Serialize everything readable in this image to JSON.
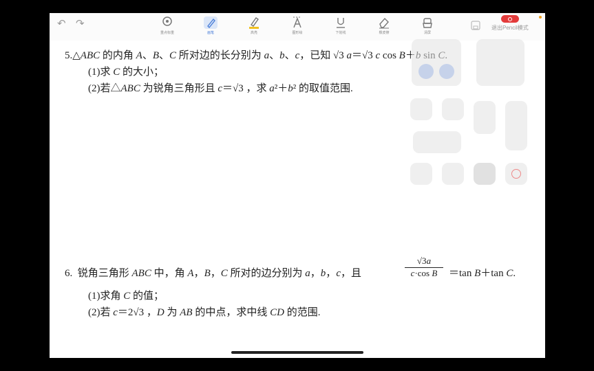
{
  "toolbar": {
    "tools": [
      {
        "label": "重点标重",
        "icon": "lasso-icon"
      },
      {
        "label": "画笔",
        "icon": "pen-icon"
      },
      {
        "label": "高亮",
        "icon": "highlighter-icon"
      },
      {
        "label": "图形绘",
        "icon": "text-icon"
      },
      {
        "label": "下划线",
        "icon": "underline-icon"
      },
      {
        "label": "橡皮擦",
        "icon": "eraser-icon"
      },
      {
        "label": "清屏",
        "icon": "clear-icon"
      }
    ],
    "exit_label": "退出Pencil模式"
  },
  "colors": {
    "accent": "#4a7ed8",
    "record": "#e33b3b",
    "status_dot": "#f0a020",
    "highlight": "#f0c020"
  },
  "problem5": {
    "q_num": "5.",
    "stem_a": "△",
    "stem_b": "ABC",
    "stem_c": " 的内角 ",
    "stem_d": "A",
    "stem_e": "、",
    "stem_f": "B",
    "stem_g": "、",
    "stem_h": "C",
    "stem_i": " 所对边的长分别为 ",
    "stem_j": "a",
    "stem_k": "、",
    "stem_l": "b",
    "stem_m": "、",
    "stem_n": "c",
    "stem_o": "，已知 √3  ",
    "stem_p": "a",
    "stem_q": "＝√3  ",
    "stem_r": "c",
    "stem_s": " cos ",
    "stem_t": "B",
    "stem_u": "＋",
    "stem_v": "b",
    "stem_w": " sin ",
    "stem_x": "C",
    "stem_y": ".",
    "part1_a": "(1)求 ",
    "part1_b": "C",
    "part1_c": " 的大小；",
    "part2_a": "(2)若△",
    "part2_b": "ABC",
    "part2_c": " 为锐角三角形且 ",
    "part2_d": "c",
    "part2_e": "＝√3 ，求 ",
    "part2_f": "a",
    "part2_g": "²＋",
    "part2_h": "b",
    "part2_i": "² 的取值范围."
  },
  "problem6": {
    "q_num": "6.",
    "stem_a": "锐角三角形 ",
    "stem_b": "ABC",
    "stem_c": " 中，角 ",
    "stem_d": "A",
    "stem_e": "，",
    "stem_f": "B",
    "stem_g": "，",
    "stem_h": "C",
    "stem_i": " 所对的边分别为 ",
    "stem_j": "a",
    "stem_k": "，",
    "stem_l": "b",
    "stem_m": "，",
    "stem_n": "c",
    "stem_o": "，且",
    "frac_num_a": "√3",
    "frac_num_b": "a",
    "frac_den_a": "c",
    "frac_den_b": "·cos ",
    "frac_den_c": "B",
    "stem_p": "＝tan ",
    "stem_q": "B",
    "stem_r": "＋tan ",
    "stem_s": "C",
    "stem_t": ".",
    "part1_a": "(1)求角 ",
    "part1_b": "C",
    "part1_c": " 的值；",
    "part2_a": "(2)若 ",
    "part2_b": "c",
    "part2_c": "＝2√3 ，",
    "part2_d": "D",
    "part2_e": " 为 ",
    "part2_f": "AB",
    "part2_g": " 的中点，求中线 ",
    "part2_h": "CD",
    "part2_i": " 的范围."
  }
}
